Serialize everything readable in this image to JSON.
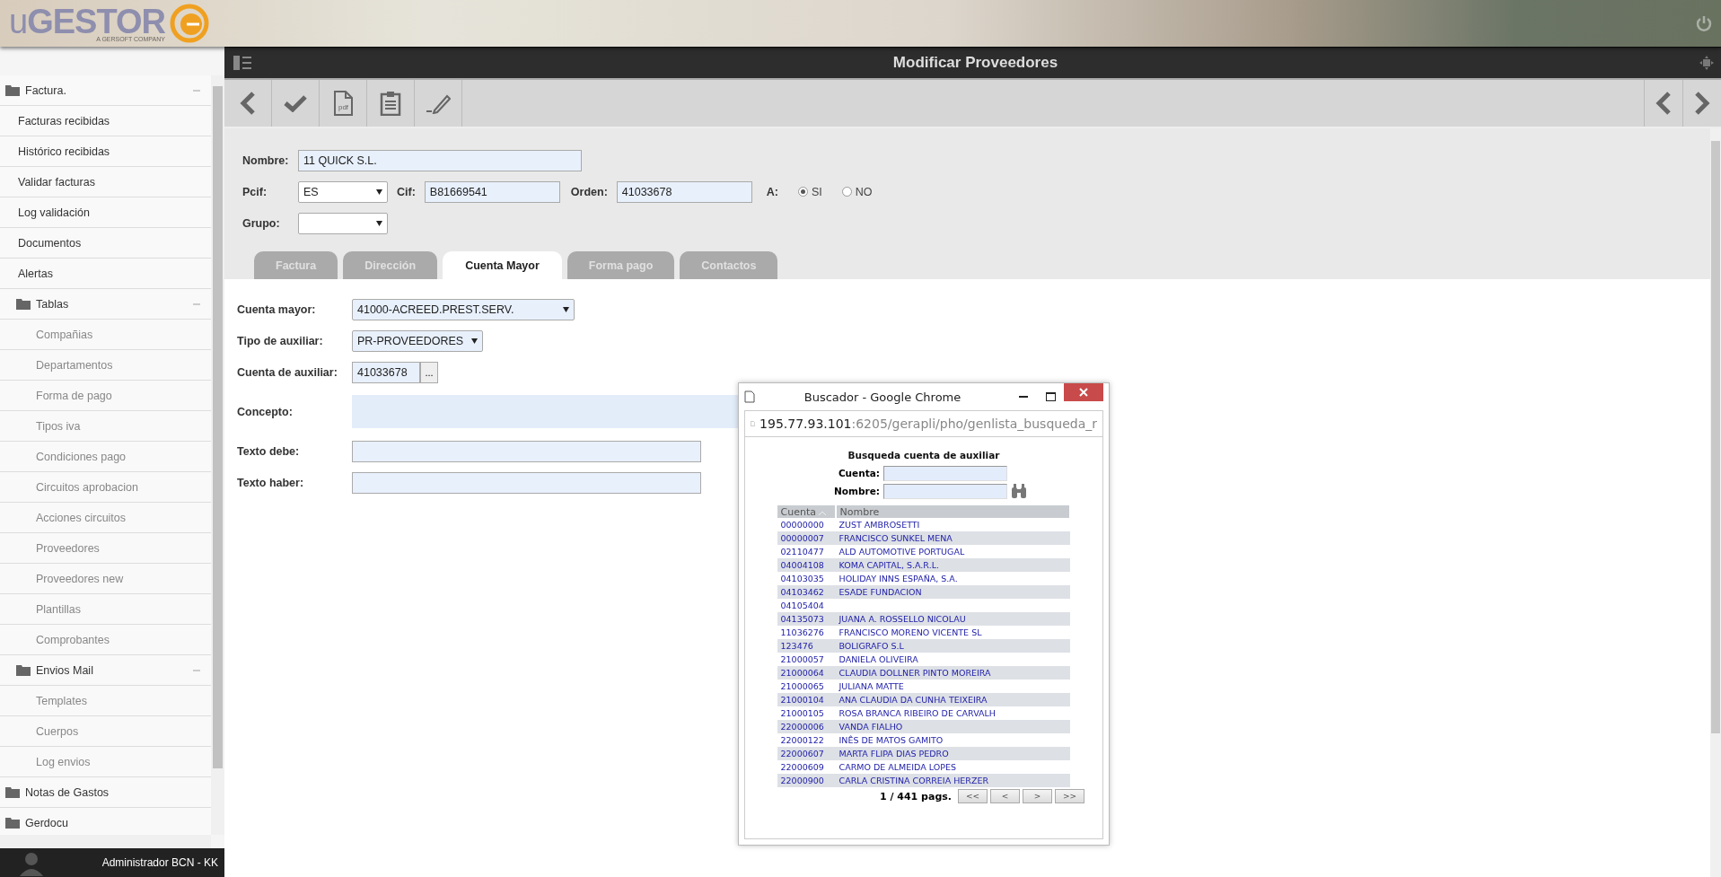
{
  "header": {
    "logo": "u**GESTOR**",
    "logo_subtitle": "A GERSOFT COMPANY"
  },
  "sidebar": {
    "items": [
      {
        "label": "Factura.",
        "kind": "folder",
        "expanded": true,
        "children": [
          {
            "label": "Facturas recibidas",
            "kind": "link"
          },
          {
            "label": "Histórico recibidas",
            "kind": "link"
          },
          {
            "label": "Validar facturas",
            "kind": "link"
          },
          {
            "label": "Log validación",
            "kind": "link"
          },
          {
            "label": "Documentos",
            "kind": "link"
          },
          {
            "label": "Alertas",
            "kind": "link"
          },
          {
            "label": "Tablas",
            "kind": "folder",
            "expanded": true,
            "children": [
              {
                "label": "Compañias",
                "kind": "link"
              },
              {
                "label": "Departamentos",
                "kind": "link"
              },
              {
                "label": "Forma de pago",
                "kind": "link"
              },
              {
                "label": "Tipos iva",
                "kind": "link"
              },
              {
                "label": "Condiciones pago",
                "kind": "link"
              },
              {
                "label": "Circuitos aprobacion",
                "kind": "link"
              },
              {
                "label": "Acciones circuitos",
                "kind": "link"
              },
              {
                "label": "Proveedores",
                "kind": "link"
              },
              {
                "label": "Proveedores new",
                "kind": "link"
              },
              {
                "label": "Plantillas",
                "kind": "link"
              },
              {
                "label": "Comprobantes",
                "kind": "link"
              }
            ]
          },
          {
            "label": "Envios Mail",
            "kind": "folder",
            "expanded": true,
            "children": [
              {
                "label": "Templates",
                "kind": "link"
              },
              {
                "label": "Cuerpos",
                "kind": "link"
              },
              {
                "label": "Log envios",
                "kind": "link"
              }
            ]
          }
        ]
      },
      {
        "label": "Notas de Gastos",
        "kind": "folder",
        "expanded": false
      },
      {
        "label": "Gerdocu",
        "kind": "folder",
        "expanded": false
      }
    ],
    "user": "Administrador BCN - KK"
  },
  "title_bar": {
    "title": "Modificar Proveedores"
  },
  "toolbar": {
    "buttons": [
      {
        "kind": "back"
      },
      {
        "kind": "check"
      },
      {
        "kind": "pdf",
        "label": "pdf"
      },
      {
        "kind": "clipboard"
      },
      {
        "kind": "edit"
      }
    ],
    "nav": [
      {
        "kind": "prev"
      },
      {
        "kind": "next"
      }
    ]
  },
  "form": {
    "nombre": {
      "label": "Nombre:",
      "value": "11 QUICK S.L."
    },
    "pcif": {
      "label": "Pcif:",
      "value": "ES"
    },
    "cif": {
      "label": "Cif:",
      "value": "B81669541"
    },
    "orden": {
      "label": "Orden:",
      "value": "41033678"
    },
    "a": {
      "label": "A:",
      "options": [
        {
          "label": "SI",
          "selected": true
        },
        {
          "label": "NO",
          "selected": false
        }
      ]
    },
    "grupo": {
      "label": "Grupo:"
    }
  },
  "tabs": [
    {
      "label": "Factura",
      "selected": false
    },
    {
      "label": "Dirección",
      "selected": false
    },
    {
      "label": "Cuenta Mayor",
      "selected": true
    },
    {
      "label": "Forma pago",
      "selected": false
    },
    {
      "label": "Contactos",
      "selected": false
    }
  ],
  "cuenta_mayor": {
    "cuenta_mayor": {
      "label": "Cuenta mayor:",
      "value": "41000-ACREED.PREST.SERV."
    },
    "tipo_auxiliar": {
      "label": "Tipo de auxiliar:",
      "value": "PR-PROVEEDORES"
    },
    "cuenta_auxiliar": {
      "label": "Cuenta de auxiliar:",
      "value": "41033678",
      "button": "..."
    },
    "concepto": {
      "label": "Concepto:"
    },
    "texto_debe": {
      "label": "Texto debe:"
    },
    "texto_haber": {
      "label": "Texto haber:"
    }
  },
  "popup": {
    "window_title": "Buscador - Google Chrome",
    "url_host": "195.77.93.101",
    "url_path": ":6205/gerapli/pho/genlista_busqueda_r",
    "heading": "Busqueda cuenta de auxiliar",
    "cuenta_label": "Cuenta:",
    "nombre_label": "Nombre:",
    "columns": [
      "Cuenta",
      "Nombre"
    ],
    "rows": [
      [
        "00000000",
        "ZUST AMBROSETTI"
      ],
      [
        "00000007",
        "FRANCISCO SUNKEL MENA"
      ],
      [
        "02110477",
        "ALD AUTOMOTIVE PORTUGAL"
      ],
      [
        "04004108",
        "KOMA CAPITAL, S.A.R.L."
      ],
      [
        "04103035",
        "HOLIDAY INNS ESPAÑA, S.A."
      ],
      [
        "04103462",
        "ESADE FUNDACION"
      ],
      [
        "04105404",
        ""
      ],
      [
        "04135073",
        "JUANA A. ROSSELLO NICOLAU"
      ],
      [
        "11036276",
        "FRANCISCO MORENO VICENTE SL"
      ],
      [
        "123476",
        "BOLIGRAFO S.L"
      ],
      [
        "21000057",
        "DANIELA OLIVEIRA"
      ],
      [
        "21000064",
        "CLAUDIA DOLLNER PINTO MOREIRA"
      ],
      [
        "21000065",
        "JULIANA MATTE"
      ],
      [
        "21000104",
        "ANA CLAUDIA DA CUNHA TEIXEIRA"
      ],
      [
        "21000105",
        "ROSA BRANCA RIBEIRO DE CARVALH"
      ],
      [
        "22000006",
        "VANDA FIALHO"
      ],
      [
        "22000122",
        "INÊS DE MATOS GAMITO"
      ],
      [
        "22000607",
        "MARTA FLIPA DIAS PEDRO"
      ],
      [
        "22000609",
        "CARMO DE ALMEIDA LOPES"
      ],
      [
        "22000900",
        "CARLA CRISTINA CORREIA HERZER"
      ]
    ],
    "pager": "1 / 441 pags.",
    "pager_buttons": [
      "<<",
      "<",
      ">",
      ">>"
    ]
  }
}
